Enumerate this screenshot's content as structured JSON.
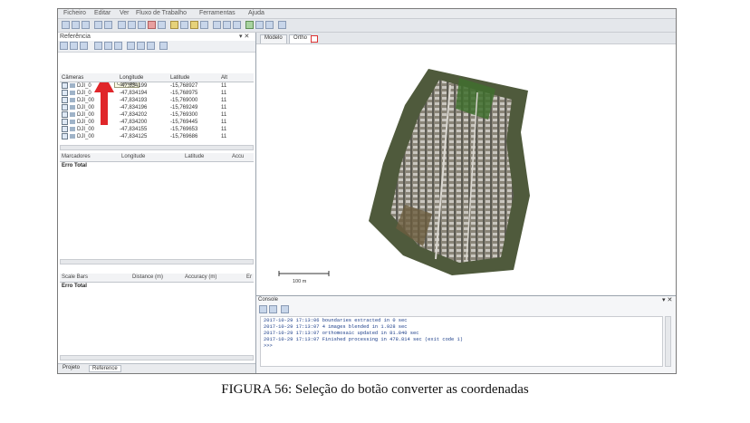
{
  "app": {
    "menu": [
      "Ficheiro",
      "Editar",
      "Ver",
      "Fluxo de Trabalho",
      "Ferramentas",
      "Ajuda"
    ]
  },
  "left_panel": {
    "title": "Referência",
    "tooltip": "Converter",
    "cameras": {
      "headers": [
        "Câmeras",
        "Longitude",
        "Latitude",
        "Alt"
      ],
      "rows": [
        [
          "DJI_0",
          "-47,834199",
          "-15,768927",
          "11"
        ],
        [
          "DJI_0",
          "-47,834194",
          "-15,768975",
          "11"
        ],
        [
          "DJI_00",
          "-47,834193",
          "-15,769000",
          "11"
        ],
        [
          "DJI_00",
          "-47,834196",
          "-15,769249",
          "11"
        ],
        [
          "DJI_00",
          "-47,834202",
          "-15,769300",
          "11"
        ],
        [
          "DJI_00",
          "-47,834200",
          "-15,769445",
          "11"
        ],
        [
          "DJI_00",
          "-47,834155",
          "-15,769653",
          "11"
        ],
        [
          "DJI_00",
          "-47,834125",
          "-15,769686",
          "11"
        ]
      ]
    },
    "markers": {
      "headers": [
        "Marcadores",
        "Longitude",
        "Latitude",
        "Accu"
      ],
      "total": "Erro Total"
    },
    "scalebars": {
      "headers": [
        "Scale Bars",
        "Distance (m)",
        "Accuracy (m)",
        "Er"
      ],
      "total": "Erro Total"
    },
    "bottom_tabs": [
      "Projeto",
      "Reference"
    ]
  },
  "view": {
    "tabs": [
      "Modelo",
      "Ortho"
    ],
    "scale_label": "100 m"
  },
  "console": {
    "title": "Console",
    "lines": [
      "2017-10-29 17:13:06 boundaries extracted in 0 sec",
      "2017-10-29 17:13:07 4 images blended in 1.928 sec",
      "2017-10-29 17:13:07 orthomosaic updated in 81.840 sec",
      "2017-10-29 17:13:07 Finished processing in 478.814 sec (exit code 1)",
      ">>>"
    ]
  },
  "caption": "FIGURA 56: Seleção do botão converter as coordenadas",
  "colors": {
    "accent_red": "#e0262a",
    "log_text": "#1d3f8a"
  }
}
